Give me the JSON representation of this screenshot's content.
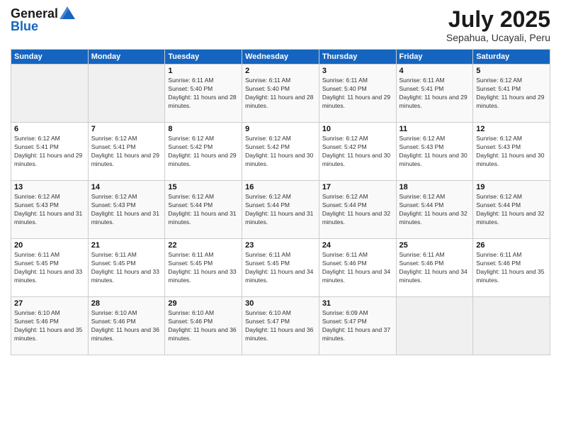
{
  "logo": {
    "general": "General",
    "blue": "Blue"
  },
  "header": {
    "month": "July 2025",
    "location": "Sepahua, Ucayali, Peru"
  },
  "weekdays": [
    "Sunday",
    "Monday",
    "Tuesday",
    "Wednesday",
    "Thursday",
    "Friday",
    "Saturday"
  ],
  "weeks": [
    [
      {
        "day": "",
        "sunrise": "",
        "sunset": "",
        "daylight": ""
      },
      {
        "day": "",
        "sunrise": "",
        "sunset": "",
        "daylight": ""
      },
      {
        "day": "1",
        "sunrise": "Sunrise: 6:11 AM",
        "sunset": "Sunset: 5:40 PM",
        "daylight": "Daylight: 11 hours and 28 minutes."
      },
      {
        "day": "2",
        "sunrise": "Sunrise: 6:11 AM",
        "sunset": "Sunset: 5:40 PM",
        "daylight": "Daylight: 11 hours and 28 minutes."
      },
      {
        "day": "3",
        "sunrise": "Sunrise: 6:11 AM",
        "sunset": "Sunset: 5:40 PM",
        "daylight": "Daylight: 11 hours and 29 minutes."
      },
      {
        "day": "4",
        "sunrise": "Sunrise: 6:11 AM",
        "sunset": "Sunset: 5:41 PM",
        "daylight": "Daylight: 11 hours and 29 minutes."
      },
      {
        "day": "5",
        "sunrise": "Sunrise: 6:12 AM",
        "sunset": "Sunset: 5:41 PM",
        "daylight": "Daylight: 11 hours and 29 minutes."
      }
    ],
    [
      {
        "day": "6",
        "sunrise": "Sunrise: 6:12 AM",
        "sunset": "Sunset: 5:41 PM",
        "daylight": "Daylight: 11 hours and 29 minutes."
      },
      {
        "day": "7",
        "sunrise": "Sunrise: 6:12 AM",
        "sunset": "Sunset: 5:41 PM",
        "daylight": "Daylight: 11 hours and 29 minutes."
      },
      {
        "day": "8",
        "sunrise": "Sunrise: 6:12 AM",
        "sunset": "Sunset: 5:42 PM",
        "daylight": "Daylight: 11 hours and 29 minutes."
      },
      {
        "day": "9",
        "sunrise": "Sunrise: 6:12 AM",
        "sunset": "Sunset: 5:42 PM",
        "daylight": "Daylight: 11 hours and 30 minutes."
      },
      {
        "day": "10",
        "sunrise": "Sunrise: 6:12 AM",
        "sunset": "Sunset: 5:42 PM",
        "daylight": "Daylight: 11 hours and 30 minutes."
      },
      {
        "day": "11",
        "sunrise": "Sunrise: 6:12 AM",
        "sunset": "Sunset: 5:43 PM",
        "daylight": "Daylight: 11 hours and 30 minutes."
      },
      {
        "day": "12",
        "sunrise": "Sunrise: 6:12 AM",
        "sunset": "Sunset: 5:43 PM",
        "daylight": "Daylight: 11 hours and 30 minutes."
      }
    ],
    [
      {
        "day": "13",
        "sunrise": "Sunrise: 6:12 AM",
        "sunset": "Sunset: 5:43 PM",
        "daylight": "Daylight: 11 hours and 31 minutes."
      },
      {
        "day": "14",
        "sunrise": "Sunrise: 6:12 AM",
        "sunset": "Sunset: 5:43 PM",
        "daylight": "Daylight: 11 hours and 31 minutes."
      },
      {
        "day": "15",
        "sunrise": "Sunrise: 6:12 AM",
        "sunset": "Sunset: 5:44 PM",
        "daylight": "Daylight: 11 hours and 31 minutes."
      },
      {
        "day": "16",
        "sunrise": "Sunrise: 6:12 AM",
        "sunset": "Sunset: 5:44 PM",
        "daylight": "Daylight: 11 hours and 31 minutes."
      },
      {
        "day": "17",
        "sunrise": "Sunrise: 6:12 AM",
        "sunset": "Sunset: 5:44 PM",
        "daylight": "Daylight: 11 hours and 32 minutes."
      },
      {
        "day": "18",
        "sunrise": "Sunrise: 6:12 AM",
        "sunset": "Sunset: 5:44 PM",
        "daylight": "Daylight: 11 hours and 32 minutes."
      },
      {
        "day": "19",
        "sunrise": "Sunrise: 6:12 AM",
        "sunset": "Sunset: 5:44 PM",
        "daylight": "Daylight: 11 hours and 32 minutes."
      }
    ],
    [
      {
        "day": "20",
        "sunrise": "Sunrise: 6:11 AM",
        "sunset": "Sunset: 5:45 PM",
        "daylight": "Daylight: 11 hours and 33 minutes."
      },
      {
        "day": "21",
        "sunrise": "Sunrise: 6:11 AM",
        "sunset": "Sunset: 5:45 PM",
        "daylight": "Daylight: 11 hours and 33 minutes."
      },
      {
        "day": "22",
        "sunrise": "Sunrise: 6:11 AM",
        "sunset": "Sunset: 5:45 PM",
        "daylight": "Daylight: 11 hours and 33 minutes."
      },
      {
        "day": "23",
        "sunrise": "Sunrise: 6:11 AM",
        "sunset": "Sunset: 5:45 PM",
        "daylight": "Daylight: 11 hours and 34 minutes."
      },
      {
        "day": "24",
        "sunrise": "Sunrise: 6:11 AM",
        "sunset": "Sunset: 5:46 PM",
        "daylight": "Daylight: 11 hours and 34 minutes."
      },
      {
        "day": "25",
        "sunrise": "Sunrise: 6:11 AM",
        "sunset": "Sunset: 5:46 PM",
        "daylight": "Daylight: 11 hours and 34 minutes."
      },
      {
        "day": "26",
        "sunrise": "Sunrise: 6:11 AM",
        "sunset": "Sunset: 5:46 PM",
        "daylight": "Daylight: 11 hours and 35 minutes."
      }
    ],
    [
      {
        "day": "27",
        "sunrise": "Sunrise: 6:10 AM",
        "sunset": "Sunset: 5:46 PM",
        "daylight": "Daylight: 11 hours and 35 minutes."
      },
      {
        "day": "28",
        "sunrise": "Sunrise: 6:10 AM",
        "sunset": "Sunset: 5:46 PM",
        "daylight": "Daylight: 11 hours and 36 minutes."
      },
      {
        "day": "29",
        "sunrise": "Sunrise: 6:10 AM",
        "sunset": "Sunset: 5:46 PM",
        "daylight": "Daylight: 11 hours and 36 minutes."
      },
      {
        "day": "30",
        "sunrise": "Sunrise: 6:10 AM",
        "sunset": "Sunset: 5:47 PM",
        "daylight": "Daylight: 11 hours and 36 minutes."
      },
      {
        "day": "31",
        "sunrise": "Sunrise: 6:09 AM",
        "sunset": "Sunset: 5:47 PM",
        "daylight": "Daylight: 11 hours and 37 minutes."
      },
      {
        "day": "",
        "sunrise": "",
        "sunset": "",
        "daylight": ""
      },
      {
        "day": "",
        "sunrise": "",
        "sunset": "",
        "daylight": ""
      }
    ]
  ]
}
